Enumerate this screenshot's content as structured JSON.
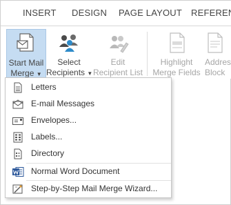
{
  "tabs": [
    "INSERT",
    "DESIGN",
    "PAGE LAYOUT",
    "REFERENC"
  ],
  "ribbon": {
    "start_mail_merge": {
      "line1": "Start Mail",
      "line2": "Merge",
      "icon": "start-mail-merge-icon"
    },
    "select_recipients": {
      "line1": "Select",
      "line2": "Recipients",
      "icon": "select-recipients-icon"
    },
    "edit_recipient_list": {
      "line1": "Edit",
      "line2": "Recipient List",
      "icon": "edit-recipient-list-icon"
    },
    "highlight_merge_fields": {
      "line1": "Highlight",
      "line2": "Merge Fields",
      "icon": "highlight-merge-fields-icon"
    },
    "address_block": {
      "line1": "Addres",
      "line2": "Block",
      "icon": "address-block-icon"
    }
  },
  "menu": {
    "items": [
      {
        "label": "Letters",
        "icon": "letters-icon"
      },
      {
        "label": "E-mail Messages",
        "icon": "email-messages-icon"
      },
      {
        "label": "Envelopes...",
        "icon": "envelopes-icon"
      },
      {
        "label": "Labels...",
        "icon": "labels-icon"
      },
      {
        "label": "Directory",
        "icon": "directory-icon"
      },
      {
        "label": "Normal Word Document",
        "icon": "word-document-icon"
      },
      {
        "label": "Step-by-Step Mail Merge Wizard...",
        "icon": "wizard-icon"
      }
    ]
  },
  "colors": {
    "accent": "#c5dcf2",
    "word_blue": "#2b579a",
    "disabled_text": "#a6a6a6"
  }
}
